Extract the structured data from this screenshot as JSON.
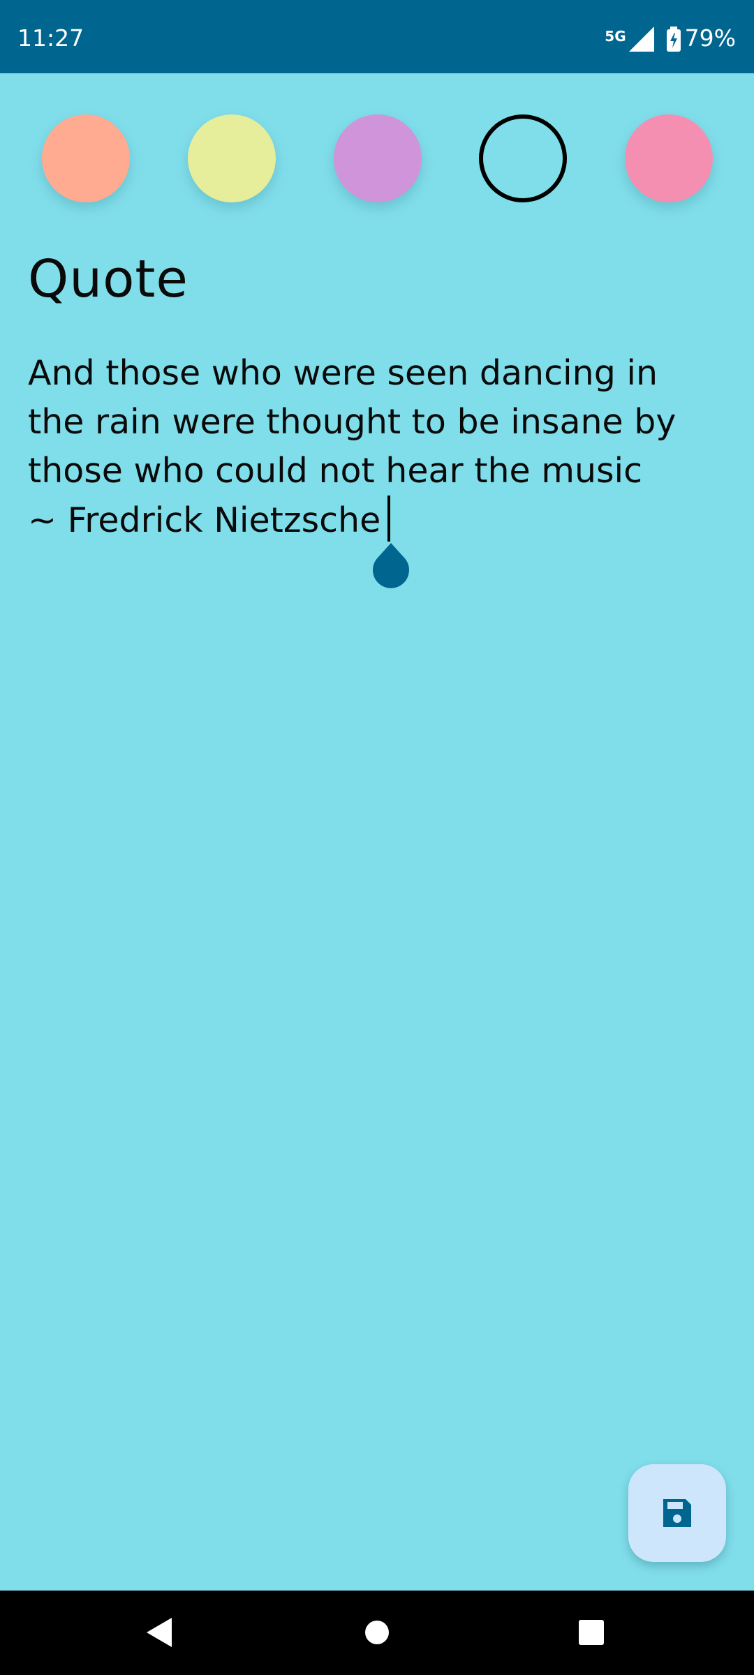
{
  "status_bar": {
    "time": "11:27",
    "network": "5G",
    "battery_percent": "79%",
    "background_color": "#006690",
    "icons": [
      "signal-icon",
      "battery-charging-icon"
    ]
  },
  "color_picker": {
    "swatches": [
      {
        "name": "peach",
        "color": "#FFAB91",
        "selected": false
      },
      {
        "name": "yellow",
        "color": "#E6EE9B",
        "selected": false
      },
      {
        "name": "purple",
        "color": "#CF94DA",
        "selected": false
      },
      {
        "name": "cyan",
        "color": "#80DEEA",
        "selected": true
      },
      {
        "name": "pink",
        "color": "#F48FB1",
        "selected": false
      }
    ]
  },
  "note": {
    "title": "Quote",
    "body_lines": [
      "And those who were seen dancing in",
      "the rain were thought to be insane by",
      "those who could not hear the music",
      "~ Fredrick Nietzsche"
    ],
    "background_color": "#80DEEA"
  },
  "fab": {
    "icon": "save-icon",
    "background_color": "#CDE6FB",
    "icon_color": "#006690"
  },
  "nav_bar": {
    "icons": [
      "back-icon",
      "home-icon",
      "recents-icon"
    ]
  }
}
